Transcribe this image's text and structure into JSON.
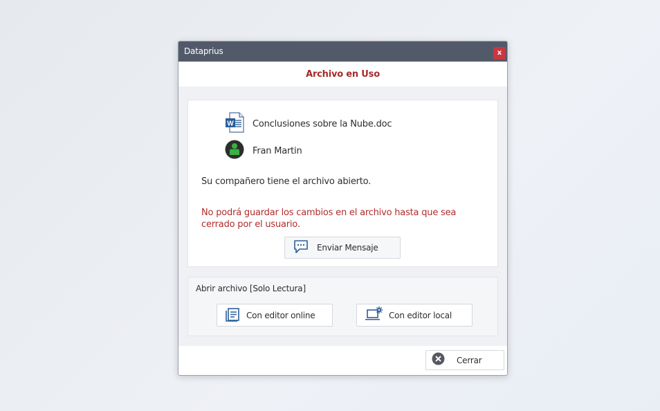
{
  "window": {
    "title": "Dataprius",
    "close_label": "x"
  },
  "dialog": {
    "heading": "Archivo en Uso",
    "file_name": "Conclusiones sobre la Nube.doc",
    "user_name": "Fran Martin",
    "info_message": "Su compañero tiene el archivo abierto.",
    "warning_message": "No podrá guardar los cambios en el archivo  hasta que sea cerrado por el usuario.",
    "send_message_label": "Enviar Mensaje",
    "open_section_title": "Abrir archivo [Solo Lectura]",
    "online_editor_label": "Con editor online",
    "local_editor_label": "Con editor local",
    "close_label": "Cerrar"
  },
  "icons": {
    "file": "word-document-icon",
    "user": "user-avatar-icon",
    "send": "chat-message-icon",
    "online": "online-editor-icon",
    "local": "laptop-gear-icon",
    "close": "close-circle-icon"
  },
  "colors": {
    "titlebar": "#525a6a",
    "heading": "#a42a2a",
    "warning": "#b12b2b",
    "close_button": "#c9373f",
    "icon_blue": "#2a5d97"
  }
}
